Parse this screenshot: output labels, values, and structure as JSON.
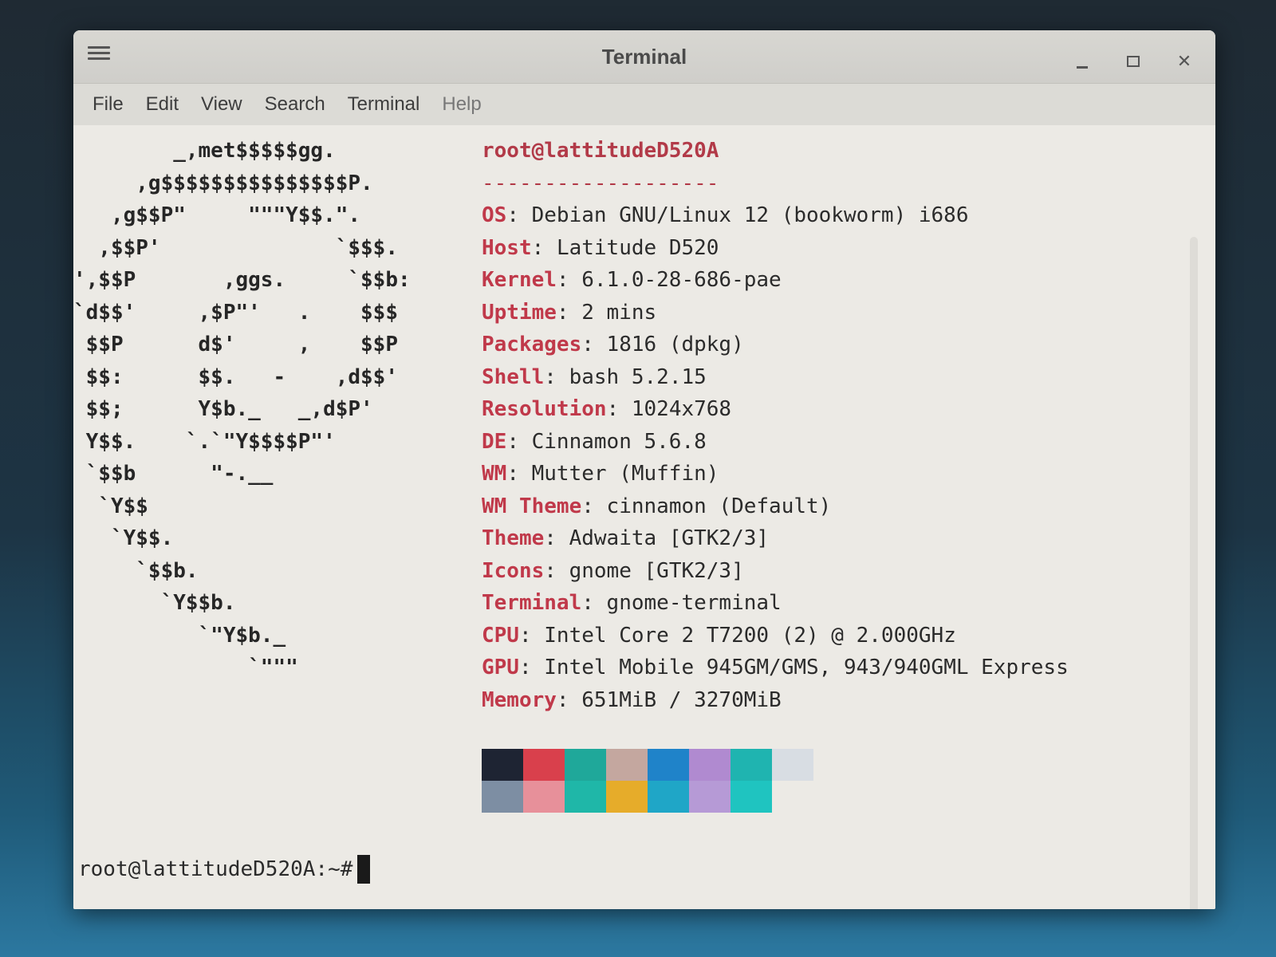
{
  "window": {
    "title": "Terminal"
  },
  "menu": {
    "items": [
      "File",
      "Edit",
      "View",
      "Search",
      "Terminal",
      "Help"
    ]
  },
  "terminal": {
    "ascii_art": [
      "        _,met$$$$$gg.",
      "     ,g$$$$$$$$$$$$$$$P.",
      "   ,g$$P\"     \"\"\"Y$$.\".",
      "  ,$$P'              `$$$.",
      "',$$P       ,ggs.     `$$b:",
      "`d$$'     ,$P\"'   .    $$$",
      " $$P      d$'     ,    $$P",
      " $$:      $$.   -    ,d$$'",
      " $$;      Y$b._   _,d$P'",
      " Y$$.    `.`\"Y$$$$P\"'",
      " `$$b      \"-.__",
      "  `Y$$",
      "   `Y$$.",
      "     `$$b.",
      "       `Y$$b.",
      "          `\"Y$b._",
      "              `\"\"\""
    ],
    "userhost": "root@lattitudeD520A",
    "separator": "-------------------",
    "info": [
      {
        "key": "OS",
        "value": "Debian GNU/Linux 12 (bookworm) i686"
      },
      {
        "key": "Host",
        "value": "Latitude D520"
      },
      {
        "key": "Kernel",
        "value": "6.1.0-28-686-pae"
      },
      {
        "key": "Uptime",
        "value": "2 mins"
      },
      {
        "key": "Packages",
        "value": "1816 (dpkg)"
      },
      {
        "key": "Shell",
        "value": "bash 5.2.15"
      },
      {
        "key": "Resolution",
        "value": "1024x768"
      },
      {
        "key": "DE",
        "value": "Cinnamon 5.6.8"
      },
      {
        "key": "WM",
        "value": "Mutter (Muffin)"
      },
      {
        "key": "WM Theme",
        "value": "cinnamon (Default)"
      },
      {
        "key": "Theme",
        "value": "Adwaita [GTK2/3]"
      },
      {
        "key": "Icons",
        "value": "gnome [GTK2/3]"
      },
      {
        "key": "Terminal",
        "value": "gnome-terminal"
      },
      {
        "key": "CPU",
        "value": "Intel Core 2 T7200 (2) @ 2.000GHz"
      },
      {
        "key": "GPU",
        "value": "Intel Mobile 945GM/GMS, 943/940GML Express"
      },
      {
        "key": "Memory",
        "value": "651MiB / 3270MiB"
      }
    ],
    "palette_top": [
      "#1e2433",
      "#d9404c",
      "#1fa89a",
      "#c4a79f",
      "#1f83c9",
      "#b08ad0",
      "#1fb4b0",
      "#d8dde3"
    ],
    "palette_bottom": [
      "#7d8ea3",
      "#e7909a",
      "#1fb7a8",
      "#e6ac2a",
      "#1fa6c7",
      "#b69ad6",
      "#1fc4c0",
      "#eceae5"
    ],
    "prompt": "root@lattitudeD520A:~#"
  }
}
